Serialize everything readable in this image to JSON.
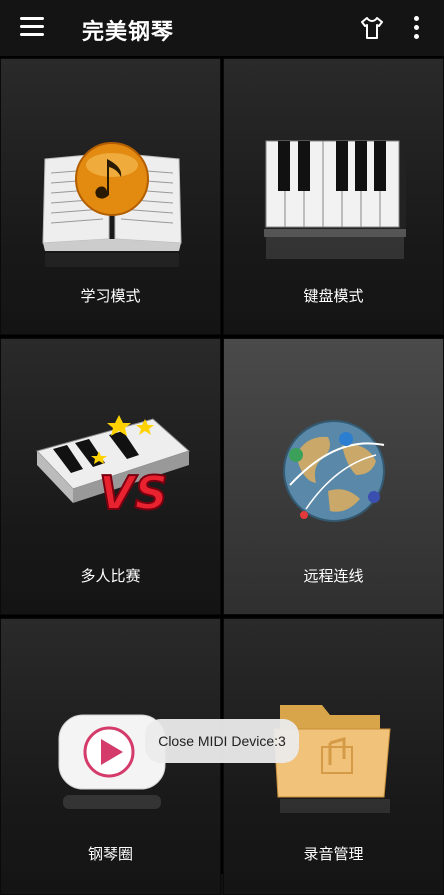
{
  "app": {
    "title": "完美钢琴"
  },
  "header": {
    "menu_icon": "hamburger-menu-icon",
    "theme_icon": "tshirt-icon",
    "more_icon": "more-vertical-icon"
  },
  "tiles": [
    {
      "label": "学习模式",
      "icon": "music-book-icon"
    },
    {
      "label": "键盘模式",
      "icon": "piano-keyboard-icon"
    },
    {
      "label": "多人比赛",
      "icon": "piano-vs-icon"
    },
    {
      "label": "远程连线",
      "icon": "globe-network-icon"
    },
    {
      "label": "钢琴圈",
      "icon": "play-video-icon"
    },
    {
      "label": "录音管理",
      "icon": "recording-folder-icon"
    }
  ],
  "toast": {
    "text": "Close MIDI Device:3"
  }
}
